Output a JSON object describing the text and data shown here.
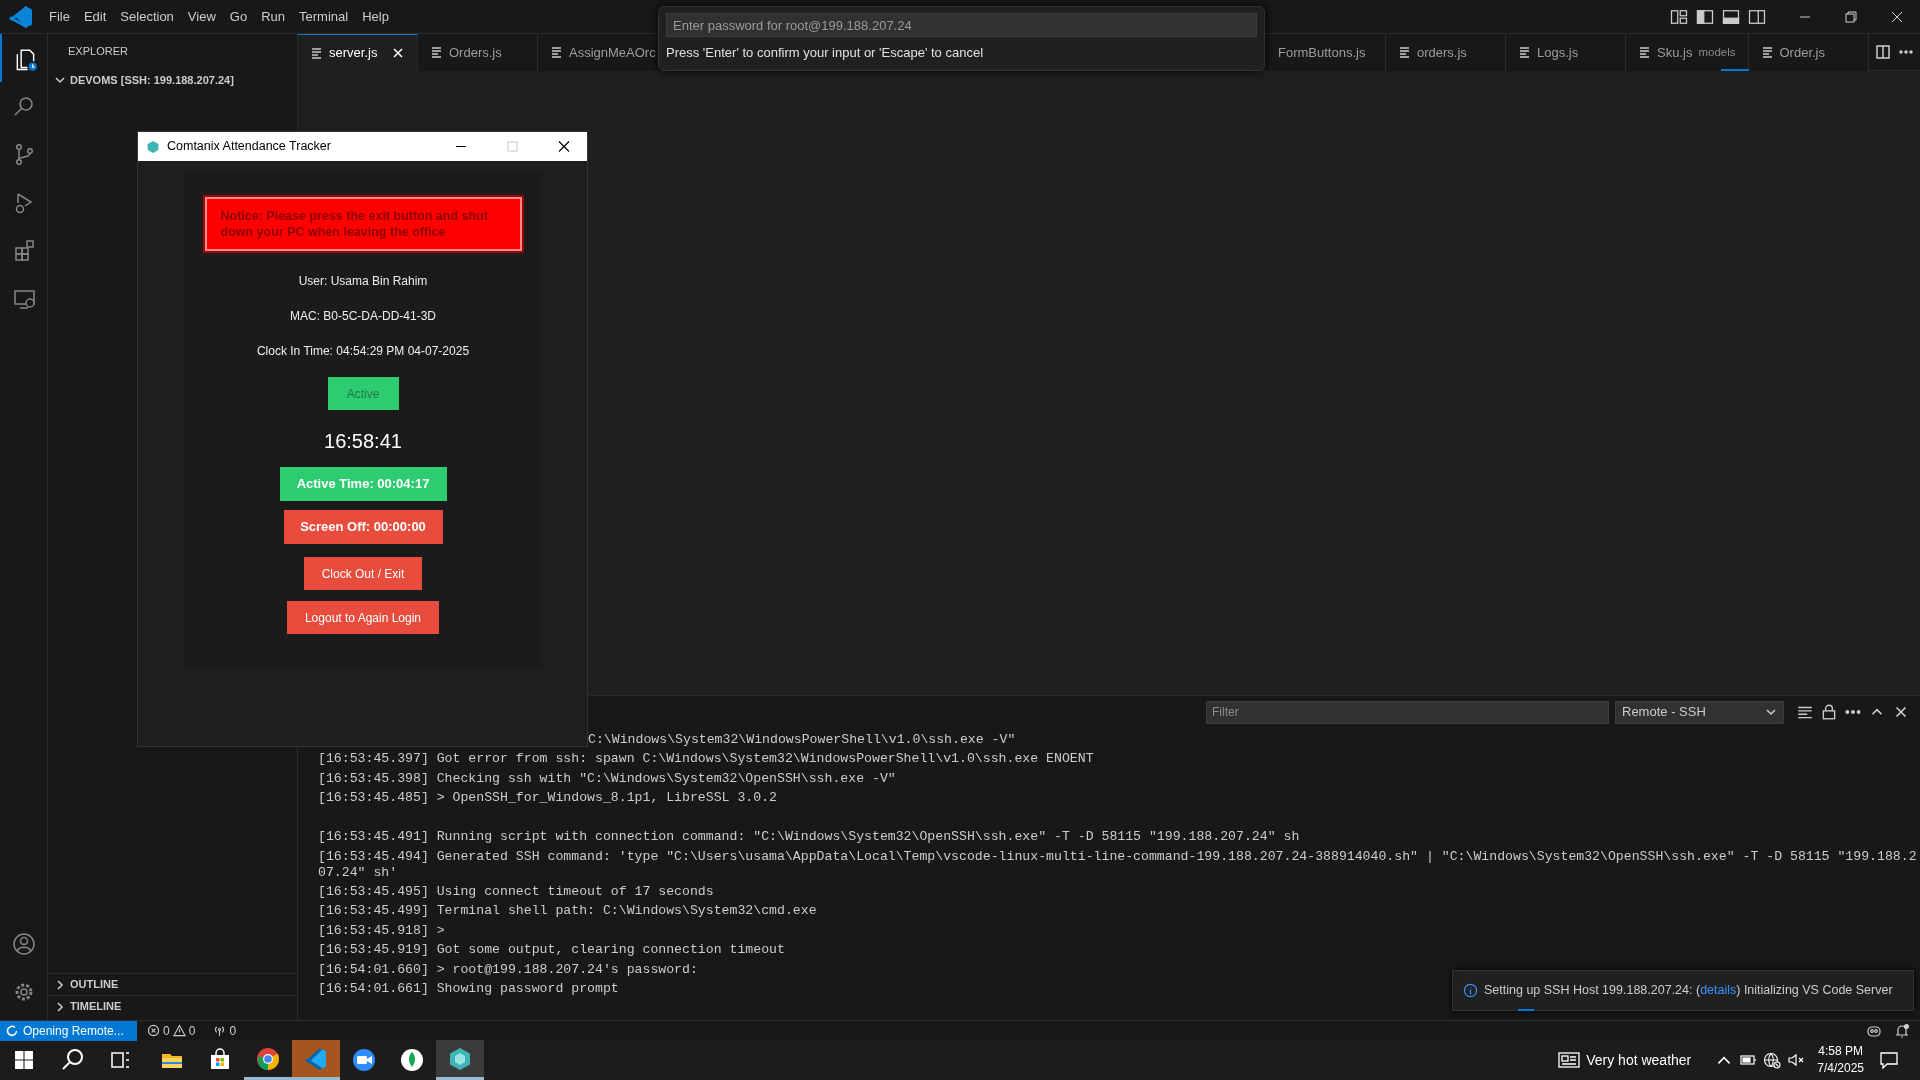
{
  "title_bar": {
    "menu": [
      "File",
      "Edit",
      "Selection",
      "View",
      "Go",
      "Run",
      "Terminal",
      "Help"
    ]
  },
  "activity_bar": [
    {
      "selected": true
    },
    {
      "selected": false
    },
    {
      "selected": false
    },
    {
      "selected": false
    },
    {
      "selected": false
    },
    {
      "selected": false
    }
  ],
  "sidebar": {
    "title": "EXPLORER",
    "folder": {
      "label": "DEVOMS [SSH: 199.188.207.24]",
      "expanded": true
    },
    "sections": [
      {
        "label": "OUTLINE",
        "expanded": false
      },
      {
        "label": "TIMELINE",
        "expanded": false
      }
    ]
  },
  "editor_tabs": {
    "left": [
      {
        "label": "server.js",
        "selected": true
      },
      {
        "label": "Orders.js",
        "selected": false
      },
      {
        "label": "AssignMeAOrc",
        "selected": false
      }
    ],
    "right": [
      {
        "label": "FormButtons.js",
        "selected": false,
        "icon": false
      },
      {
        "label": "orders.js",
        "selected": false,
        "icon": true
      },
      {
        "label": "Logs.js",
        "selected": false,
        "icon": true
      },
      {
        "label": "Sku.js",
        "description": "models",
        "selected": false,
        "icon": true
      },
      {
        "label": "Order.js",
        "selected": false,
        "icon": true
      }
    ]
  },
  "quick_input": {
    "placeholder": "Enter password for root@199.188.207.24",
    "message": "Press 'Enter' to confirm your input or 'Escape' to cancel"
  },
  "panel": {
    "filter_placeholder": "Filter",
    "channel": "Remote - SSH",
    "log": [
      {
        "kind": "partial",
        "text": "C:\\Windows\\System32\\WindowsPowerShell\\v1.0\\ssh.exe -V\""
      },
      {
        "kind": "line",
        "text": "[16:53:45.397] Got error from ssh: spawn C:\\Windows\\System32\\WindowsPowerShell\\v1.0\\ssh.exe ENOENT"
      },
      {
        "kind": "line",
        "text": "[16:53:45.398] Checking ssh with \"C:\\Windows\\System32\\OpenSSH\\ssh.exe -V\""
      },
      {
        "kind": "line",
        "text": "[16:53:45.485] > OpenSSH_for_Windows_8.1p1, LibreSSL 3.0.2"
      },
      {
        "kind": "blank"
      },
      {
        "kind": "line",
        "text": "[16:53:45.491] Running script with connection command: \"C:\\Windows\\System32\\OpenSSH\\ssh.exe\" -T -D 58115 \"199.188.207.24\" sh"
      },
      {
        "kind": "line",
        "text": "[16:53:45.494] Generated SSH command: 'type \"C:\\Users\\usama\\AppData\\Local\\Temp\\vscode-linux-multi-line-command-199.188.207.24-388914040.sh\" | \"C:\\Windows\\System32\\OpenSSH\\ssh.exe\" -T -D 58115 \"199.188.207.24\" sh'"
      },
      {
        "kind": "line",
        "text": "[16:53:45.495] Using connect timeout of 17 seconds"
      },
      {
        "kind": "line",
        "text": "[16:53:45.499] Terminal shell path: C:\\Windows\\System32\\cmd.exe"
      },
      {
        "kind": "line",
        "text": "[16:53:45.918] >"
      },
      {
        "kind": "line",
        "text": "[16:53:45.919] Got some output, clearing connection timeout"
      },
      {
        "kind": "line",
        "text": "[16:54:01.660] > root@199.188.207.24's password:"
      },
      {
        "kind": "line",
        "text": "[16:54:01.661] Showing password prompt"
      }
    ]
  },
  "app_window": {
    "title": "Comtanix Attendance Tracker",
    "maximize_disabled": true,
    "notice": "Notice: Please press the exit button and shut down your PC when leaving the office",
    "user": "User: Usama Bin Rahim",
    "mac": "MAC: B0-5C-DA-DD-41-3D",
    "clock_in": "Clock In Time: 04:54:29 PM 04-07-2025",
    "status": {
      "label": "Active",
      "active": true
    },
    "clock": "16:58:41",
    "active_time": "Active Time: 00:04:17",
    "screen_off": "Screen Off: 00:00:00",
    "buttons": [
      "Clock Out / Exit",
      "Logout to Again Login"
    ]
  },
  "notification": {
    "before": "Setting up SSH Host 199.188.207.24: (",
    "link": "details",
    "after": ") Initializing VS Code Server"
  },
  "status_bar": {
    "remote": "Opening Remote...",
    "errors": "0",
    "warnings": "0",
    "ports": "0"
  },
  "taskbar": {
    "apps": [
      {
        "running": false,
        "flashing": false,
        "selected": false
      },
      {
        "running": false,
        "flashing": false,
        "selected": false
      },
      {
        "running": true,
        "flashing": false,
        "selected": false
      },
      {
        "running": true,
        "flashing": true,
        "selected": false
      },
      {
        "running": false,
        "flashing": false,
        "selected": false
      },
      {
        "running": false,
        "flashing": false,
        "selected": false
      },
      {
        "running": true,
        "flashing": false,
        "selected": true
      }
    ],
    "weather": "Very hot weather",
    "time": "4:58 PM",
    "date": "7/4/2025"
  }
}
